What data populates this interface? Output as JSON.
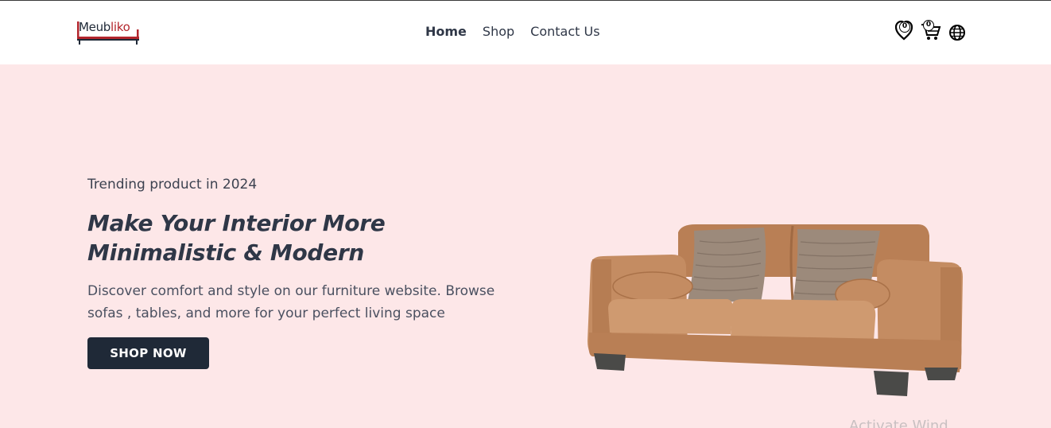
{
  "header": {
    "logo": {
      "name": "Meubliko",
      "part1": "Meub",
      "part2": "liko"
    },
    "nav": [
      {
        "label": "Home",
        "active": true
      },
      {
        "label": "Shop",
        "active": false
      },
      {
        "label": "Contact Us",
        "active": false
      }
    ],
    "wishlist_count": "0",
    "cart_count": "0",
    "icons": [
      "wishlist-icon",
      "cart-icon",
      "globe-icon"
    ]
  },
  "hero": {
    "tag": "Trending product in 2024",
    "title": "Make Your Interior More Minimalistic & Modern",
    "description": "Discover comfort and style on our furniture website. Browse sofas , tables, and more for your perfect living space",
    "button_label": "SHOP NOW",
    "image": "sofa-image"
  },
  "overlay": {
    "watermark_partial": "Activate Wind"
  },
  "colors": {
    "hero_bg": "#fde7e8",
    "button_bg": "#1f2937",
    "brand_red": "#b3262d",
    "text_dark": "#2f3747",
    "sofa": "#c48c62"
  }
}
